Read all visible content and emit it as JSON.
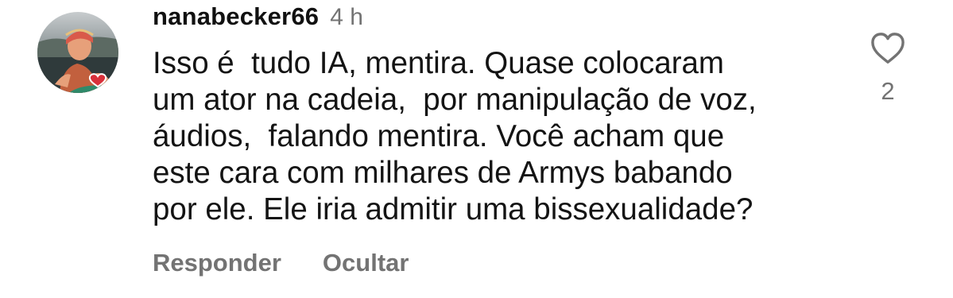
{
  "comment": {
    "username": "nanabecker66",
    "time_ago": "4 h",
    "text": "Isso é  tudo IA, mentira. Quase colocaram\num ator na cadeia,  por manipulação de voz,\náudios,  falando mentira. Você acham que\neste cara com milhares de Armys babando\npor ele. Ele iria admitir uma bissexualidade?",
    "actions": {
      "reply_label": "Responder",
      "hide_label": "Ocultar"
    },
    "likes": {
      "icon": "heart-outline-icon",
      "count": "2"
    }
  },
  "colors": {
    "text": "#141414",
    "muted": "#737373",
    "background": "#ffffff"
  }
}
